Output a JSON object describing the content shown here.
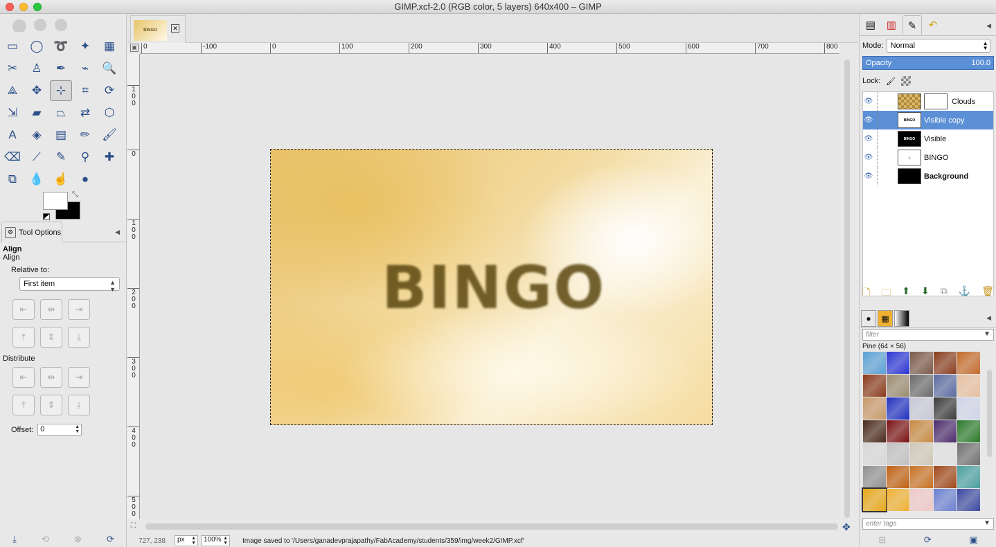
{
  "window": {
    "title": "GIMP.xcf-2.0 (RGB color, 5 layers) 640x400 – GIMP"
  },
  "toolbox": {
    "tools": [
      {
        "name": "rect-select-icon",
        "glyph": "▭"
      },
      {
        "name": "ellipse-select-icon",
        "glyph": "◯"
      },
      {
        "name": "free-select-icon",
        "glyph": "➰"
      },
      {
        "name": "fuzzy-select-icon",
        "glyph": "✦"
      },
      {
        "name": "color-select-icon",
        "glyph": "▦"
      },
      {
        "name": "scissors-select-icon",
        "glyph": "✂"
      },
      {
        "name": "foreground-select-icon",
        "glyph": "♙"
      },
      {
        "name": "paths-icon",
        "glyph": "✒"
      },
      {
        "name": "color-picker-icon",
        "glyph": "⌁"
      },
      {
        "name": "zoom-icon",
        "glyph": "🔍"
      },
      {
        "name": "measure-icon",
        "glyph": "⟁"
      },
      {
        "name": "move-icon",
        "glyph": "✥"
      },
      {
        "name": "align-icon",
        "glyph": "⊹"
      },
      {
        "name": "crop-icon",
        "glyph": "⌗"
      },
      {
        "name": "rotate-icon",
        "glyph": "⟳"
      },
      {
        "name": "scale-icon",
        "glyph": "⇲"
      },
      {
        "name": "shear-icon",
        "glyph": "▰"
      },
      {
        "name": "perspective-icon",
        "glyph": "⏢"
      },
      {
        "name": "flip-icon",
        "glyph": "⇄"
      },
      {
        "name": "cage-icon",
        "glyph": "⬡"
      },
      {
        "name": "text-icon",
        "glyph": "A"
      },
      {
        "name": "bucket-fill-icon",
        "glyph": "◈"
      },
      {
        "name": "blend-icon",
        "glyph": "▤"
      },
      {
        "name": "pencil-icon",
        "glyph": "✏"
      },
      {
        "name": "paintbrush-icon",
        "glyph": "🖌"
      },
      {
        "name": "eraser-icon",
        "glyph": "⌫"
      },
      {
        "name": "airbrush-icon",
        "glyph": "⟋"
      },
      {
        "name": "ink-icon",
        "glyph": "✎"
      },
      {
        "name": "clone-icon",
        "glyph": "⚲"
      },
      {
        "name": "heal-icon",
        "glyph": "✚"
      },
      {
        "name": "perspective-clone-icon",
        "glyph": "⧉"
      },
      {
        "name": "blur-icon",
        "glyph": "💧"
      },
      {
        "name": "smudge-icon",
        "glyph": "☝"
      },
      {
        "name": "dodge-burn-icon",
        "glyph": "●"
      }
    ],
    "tool_options_tab": "Tool Options",
    "options": {
      "title": "Align",
      "subtitle": "Align",
      "relative_label": "Relative to:",
      "relative_value": "First item",
      "distribute_label": "Distribute",
      "offset_label": "Offset:",
      "offset_value": "0"
    },
    "align_glyphs": [
      "⇤",
      "⇹",
      "⇥",
      "⤒",
      "⇕",
      "⤓"
    ],
    "distribute_glyphs": [
      "⇤",
      "⇹",
      "⇥",
      "⤒",
      "⇕",
      "⤓"
    ]
  },
  "image_tab": {
    "thumb_text": "BINGO"
  },
  "rulers": {
    "h_labels": [
      "0",
      "-100",
      "0",
      "100",
      "200",
      "300",
      "400",
      "500",
      "600",
      "700",
      "800"
    ],
    "v_labels": [
      "100",
      "0",
      "100",
      "200",
      "300",
      "400",
      "500"
    ]
  },
  "canvas": {
    "text": "BINGO"
  },
  "status": {
    "coords": "727, 238",
    "unit": "px",
    "zoom": "100%",
    "message": "Image saved to '/Users/ganadevprajapathy/FabAcademy/students/359/img/week2/GIMP.xcf'"
  },
  "layers_panel": {
    "mode_label": "Mode:",
    "mode_value": "Normal",
    "opacity_label": "Opacity",
    "opacity_value": "100.0",
    "lock_label": "Lock:",
    "layers": [
      {
        "name": "Clouds",
        "thumb": "clouds",
        "mask": true,
        "selected": false,
        "bold": false
      },
      {
        "name": "Visible copy",
        "thumb": "text",
        "mask": false,
        "selected": true,
        "bold": false
      },
      {
        "name": "Visible",
        "thumb": "black-text",
        "mask": false,
        "selected": false,
        "bold": false
      },
      {
        "name": "BINGO",
        "thumb": "bingo",
        "mask": false,
        "selected": false,
        "bold": false
      },
      {
        "name": "Background",
        "thumb": "black",
        "mask": false,
        "selected": false,
        "bold": true
      }
    ]
  },
  "patterns_panel": {
    "filter_placeholder": "filter",
    "selected_name": "Pine (64 × 56)",
    "tags_placeholder": "enter tags",
    "swatches": [
      "#5aa0d6",
      "#2a34d4",
      "#7b5a48",
      "#8a3c1c",
      "#c46a2a",
      "#8a3a1a",
      "#9a8a70",
      "#6a6a6a",
      "#5a6aa0",
      "#e8c0a0",
      "#c89868",
      "#2030c0",
      "#c8c8d8",
      "#3a3a3a",
      "#d0d4e8",
      "#4a2a1a",
      "#7a1010",
      "#c88a40",
      "#4a2a6a",
      "#2a7a2a",
      "#d8d8d8",
      "#c0c0c0",
      "#d0c8b8",
      "#e0e0e0",
      "#707070",
      "#909090",
      "#c06010",
      "#c87020",
      "#a04818",
      "#4aa0a0",
      "#e8a818",
      "#f0b030",
      "#f0c8c8",
      "#6a80d0",
      "#3a4aa0"
    ]
  }
}
